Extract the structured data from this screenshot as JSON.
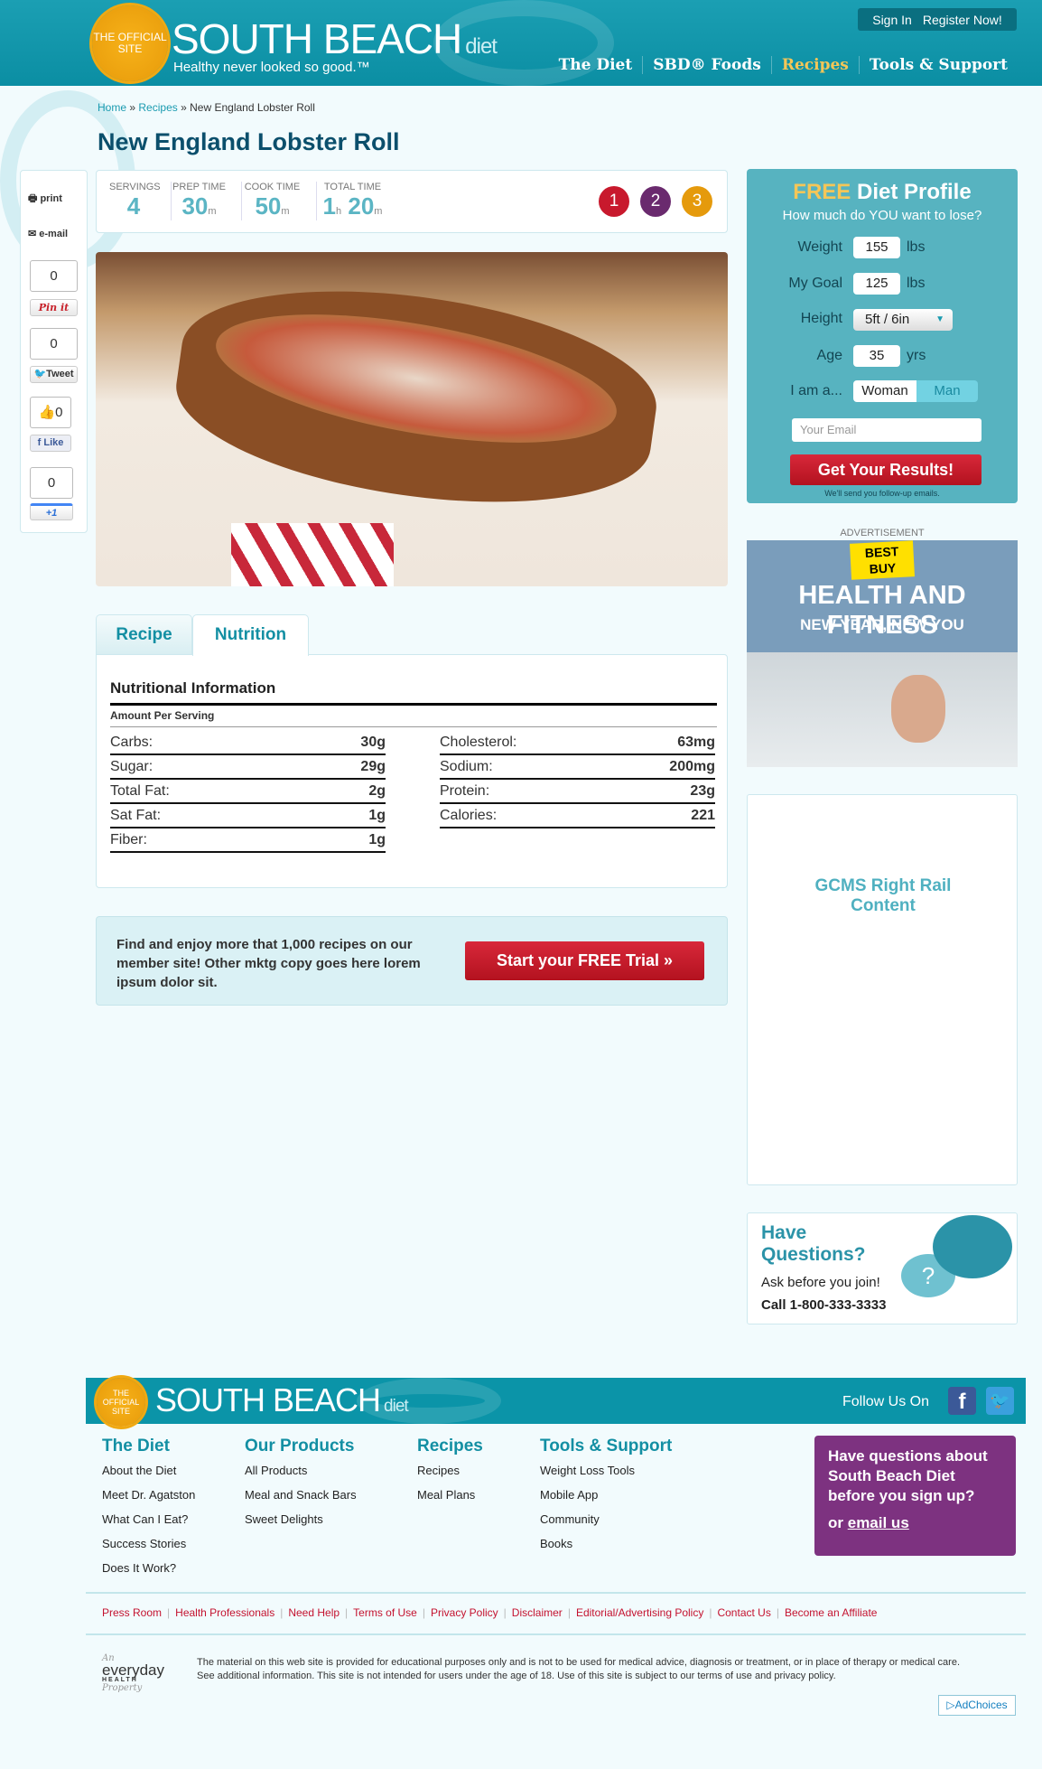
{
  "header": {
    "seal_text": "THE OFFICIAL SITE",
    "brand": "SOUTH BEACH",
    "brand_sub": "diet",
    "tagline": "Healthy never looked so good.™",
    "sign_in": "Sign In",
    "register": "Register Now!",
    "nav": [
      "The Diet",
      "SBD® Foods",
      "Recipes",
      "Tools & Support"
    ],
    "active_nav": "Recipes"
  },
  "breadcrumb": {
    "home": "Home",
    "recipes": "Recipes",
    "current": "New England Lobster Roll"
  },
  "page_title": "New England Lobster Roll",
  "share": {
    "print": "print",
    "email": "e-mail",
    "pin_count": "0",
    "pin_label": "Pin it",
    "tweet_count": "0",
    "tweet_label": "Tweet",
    "like_count": "0",
    "like_label": "Like",
    "plus_count": "0",
    "plus_label": "+1"
  },
  "stats": {
    "servings_label": "SERVINGS",
    "servings": "4",
    "prep_label": "PREP TIME",
    "prep": "30",
    "prep_unit": "m",
    "cook_label": "COOK TIME",
    "cook": "50",
    "cook_unit": "m",
    "total_label": "TOTAL TIME",
    "total_h": "1",
    "total_h_unit": "h",
    "total_m": "20",
    "total_m_unit": "m",
    "phases": [
      "1",
      "2",
      "3"
    ],
    "phase_colors": [
      "#c8192d",
      "#6a2a6e",
      "#e59a0c"
    ]
  },
  "tabs": {
    "recipe": "Recipe",
    "nutrition": "Nutrition",
    "active": "Nutrition"
  },
  "nutrition": {
    "title": "Nutritional Information",
    "subtitle": "Amount Per Serving",
    "left": [
      {
        "label": "Carbs:",
        "value": "30g"
      },
      {
        "label": "Sugar:",
        "value": "29g"
      },
      {
        "label": "Total Fat:",
        "value": "2g"
      },
      {
        "label": "Sat Fat:",
        "value": "1g"
      },
      {
        "label": "Fiber:",
        "value": "1g"
      }
    ],
    "right": [
      {
        "label": "Cholesterol:",
        "value": "63mg"
      },
      {
        "label": "Sodium:",
        "value": "200mg"
      },
      {
        "label": "Protein:",
        "value": "23g"
      },
      {
        "label": "Calories:",
        "value": "221"
      }
    ]
  },
  "cta": {
    "text": "Find and enjoy more that 1,000 recipes on our member site! Other mktg copy goes here lorem ipsum dolor sit.",
    "button": "Start your FREE Trial »"
  },
  "profile": {
    "free": "FREE",
    "title": "Diet Profile",
    "subtitle": "How much do YOU want to lose?",
    "weight_label": "Weight",
    "weight": "155",
    "weight_unit": "lbs",
    "goal_label": "My Goal",
    "goal": "125",
    "goal_unit": "lbs",
    "height_label": "Height",
    "height": "5ft / 6in",
    "age_label": "Age",
    "age": "35",
    "age_unit": "yrs",
    "gender_label": "I am a...",
    "woman": "Woman",
    "man": "Man",
    "selected_gender": "Man",
    "email_placeholder": "Your Email",
    "submit": "Get Your Results!",
    "note": "We'll send you follow-up emails."
  },
  "ad": {
    "label": "ADVERTISEMENT",
    "logo": "BEST BUY",
    "headline": "HEALTH AND FITNESS",
    "subhead": "NEW YEAR, NEW YOU"
  },
  "gcms": "GCMS Right Rail Content",
  "questions": {
    "title": "Have Questions?",
    "text": "Ask before you join!",
    "phone": "Call 1-800-333-3333"
  },
  "footer": {
    "follow": "Follow Us On",
    "columns": [
      {
        "title": "The Diet",
        "items": [
          "About the Diet",
          "Meet Dr. Agatston",
          "What Can I Eat?",
          "Success Stories",
          "Does It Work?"
        ]
      },
      {
        "title": "Our Products",
        "items": [
          "All Products",
          "Meal and Snack Bars",
          "Sweet Delights"
        ]
      },
      {
        "title": "Recipes",
        "items": [
          "Recipes",
          "Meal Plans"
        ]
      },
      {
        "title": "Tools & Support",
        "items": [
          "Weight Loss Tools",
          "Mobile App",
          "Community",
          "Books"
        ]
      }
    ],
    "question_box": "Have questions about South Beach Diet before you sign up?",
    "question_or": "or",
    "question_link": "email us",
    "links": [
      "Press Room",
      "Health Professionals",
      "Need Help",
      "Terms of Use",
      "Privacy Policy",
      "Disclaimer",
      "Editorial/Advertising Policy",
      "Contact Us",
      "Become an Affiliate"
    ],
    "eh_an": "An",
    "eh_everyday": "everyday",
    "eh_health": "HEALTH",
    "eh_property": "Property",
    "disclaimer": "The material on this web site is provided for educational purposes only and is not to be used for medical advice, diagnosis or treatment, or in place of therapy or medical care. See additional information. This site is not intended for users under the age of 18. Use of this site is subject to our terms of use and privacy policy.",
    "adchoices": "AdChoices"
  }
}
